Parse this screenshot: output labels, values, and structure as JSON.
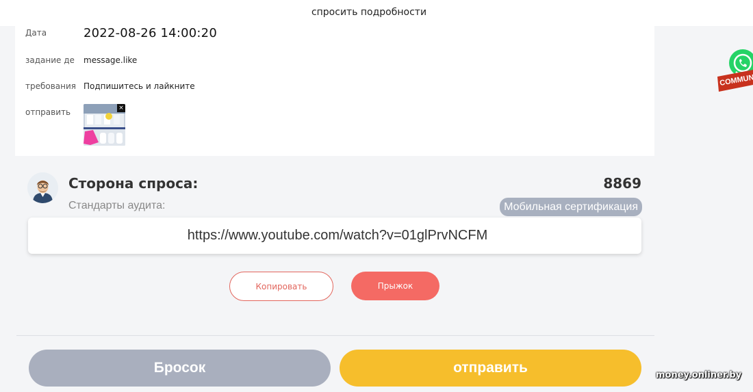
{
  "header": {
    "title": "спросить подробности"
  },
  "details": {
    "date_label": "Дата",
    "date_value": "2022-08-26 14:00:20",
    "task_label": "задание де",
    "task_value": "message.like",
    "req_label": "требования",
    "req_value": "Подпишитесь и лайкните",
    "send_label": "отправить",
    "attachment_close": "×"
  },
  "demand": {
    "title": "Сторона спроса:",
    "count": "8869",
    "audit_label": "Стандарты аудита:",
    "badge": "Мобильная сертификация"
  },
  "link": {
    "url": "https://www.youtube.com/watch?v=01glPrvNCFM"
  },
  "actions": {
    "copy": "Копировать",
    "jump": "Прыжок"
  },
  "footer": {
    "throw": "Бросок",
    "submit": "отправить"
  },
  "overlay": {
    "community": "COMMUNITY",
    "watermark": "money.onliner.by"
  },
  "colors": {
    "accent_red": "#f46a64",
    "accent_yellow": "#f6be2c",
    "muted_gray": "#a9afbe",
    "whatsapp_green": "#25d366",
    "community_red": "#c8321e"
  },
  "icons": [
    "avatar",
    "close-icon",
    "whatsapp-icon"
  ]
}
